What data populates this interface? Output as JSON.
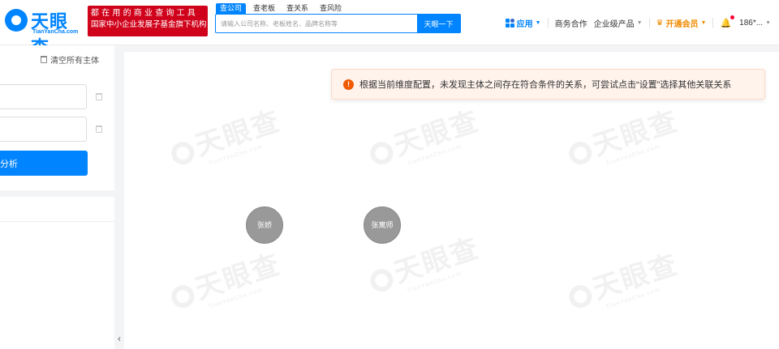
{
  "brand": {
    "name": "天眼查",
    "url": "TianYanCha.com",
    "slogan_line1": "都在用的商业查询工具",
    "slogan_line2": "国家中小企业发展子基金旗下机构"
  },
  "search": {
    "tabs": [
      "查公司",
      "查老板",
      "查关系",
      "查风险"
    ],
    "active_tab": "查公司",
    "placeholder": "请输入公司名称、老板姓名、品牌名称等",
    "button_label": "天眼一下"
  },
  "nav": {
    "apps_label": "应用",
    "business_label": "商务合作",
    "enterprise_label": "企业级产品",
    "vip_label": "开通会员",
    "user_label": "186*...",
    "accent_color": "#0084ff",
    "vip_color": "#f08a00"
  },
  "left_panel": {
    "clear_all_label": "清空所有主体",
    "entity1_value": "",
    "entity2_value": "",
    "analyze_label": "分析",
    "collapse_glyph": "‹"
  },
  "canvas": {
    "alert_text": "根据当前维度配置，未发现主体之间存在符合条件的关系，可尝试点击“设置”选择其他关联关系",
    "watermark_text": "天眼查",
    "watermark_sub": "TianYanCha.com",
    "nodes": [
      "张娇",
      "张寓师"
    ]
  }
}
